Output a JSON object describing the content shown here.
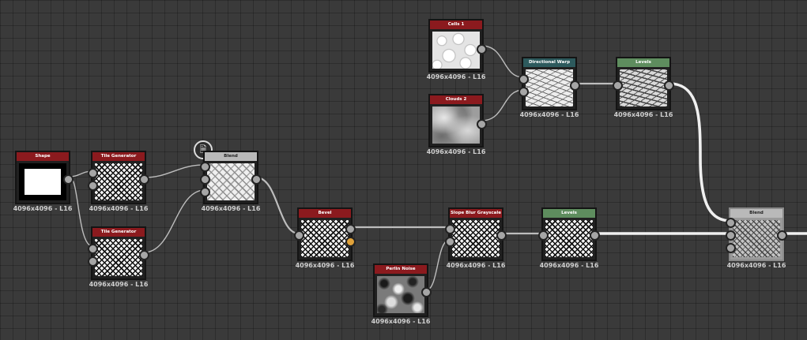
{
  "colors": {
    "canvas_bg": "#3a3a3a",
    "header_generator": "#8b1a1e",
    "header_blend": "#b9b9b9",
    "header_warp": "#2d5a5d",
    "header_levels": "#5e8d5e",
    "wire": "#bdbdbd",
    "wire_main": "#e8e8e8"
  },
  "nodes": {
    "shape": {
      "title": "Shape",
      "caption": "4096x4096 - L16",
      "header_color": "#8b1a1e"
    },
    "tile_generator_1": {
      "title": "Tile Generator",
      "caption": "4096x4096 - L16",
      "header_color": "#8b1a1e"
    },
    "tile_generator_2": {
      "title": "Tile Generator",
      "caption": "4096x4096 - L16",
      "header_color": "#8b1a1e"
    },
    "blend_1": {
      "title": "Blend",
      "caption": "4096x4096 - L16",
      "header_color": "#b9b9b9"
    },
    "bevel": {
      "title": "Bevel",
      "caption": "4096x4096 - L16",
      "header_color": "#8b1a1e"
    },
    "perlin_noise": {
      "title": "Perlin Noise",
      "caption": "4096x4096 - L16",
      "header_color": "#8b1a1e"
    },
    "slope_blur": {
      "title": "Slope Blur Grayscale",
      "caption": "4096x4096 - L16",
      "header_color": "#8b1a1e"
    },
    "levels_1": {
      "title": "Levels",
      "caption": "4096x4096 - L16",
      "header_color": "#5e8d5e"
    },
    "cells_1": {
      "title": "Cells 1",
      "caption": "4096x4096 - L16",
      "header_color": "#8b1a1e"
    },
    "clouds_2": {
      "title": "Clouds 2",
      "caption": "4096x4096 - L16",
      "header_color": "#8b1a1e"
    },
    "directional_warp": {
      "title": "Directional Warp",
      "caption": "4096x4096 - L16",
      "header_color": "#2d5a5d"
    },
    "levels_2": {
      "title": "Levels",
      "caption": "4096x4096 - L16",
      "header_color": "#5e8d5e"
    },
    "blend_2": {
      "title": "Blend",
      "caption": "4096x4096 - L16",
      "header_color": "#b9b9b9"
    }
  },
  "comment_icon": "document-icon"
}
